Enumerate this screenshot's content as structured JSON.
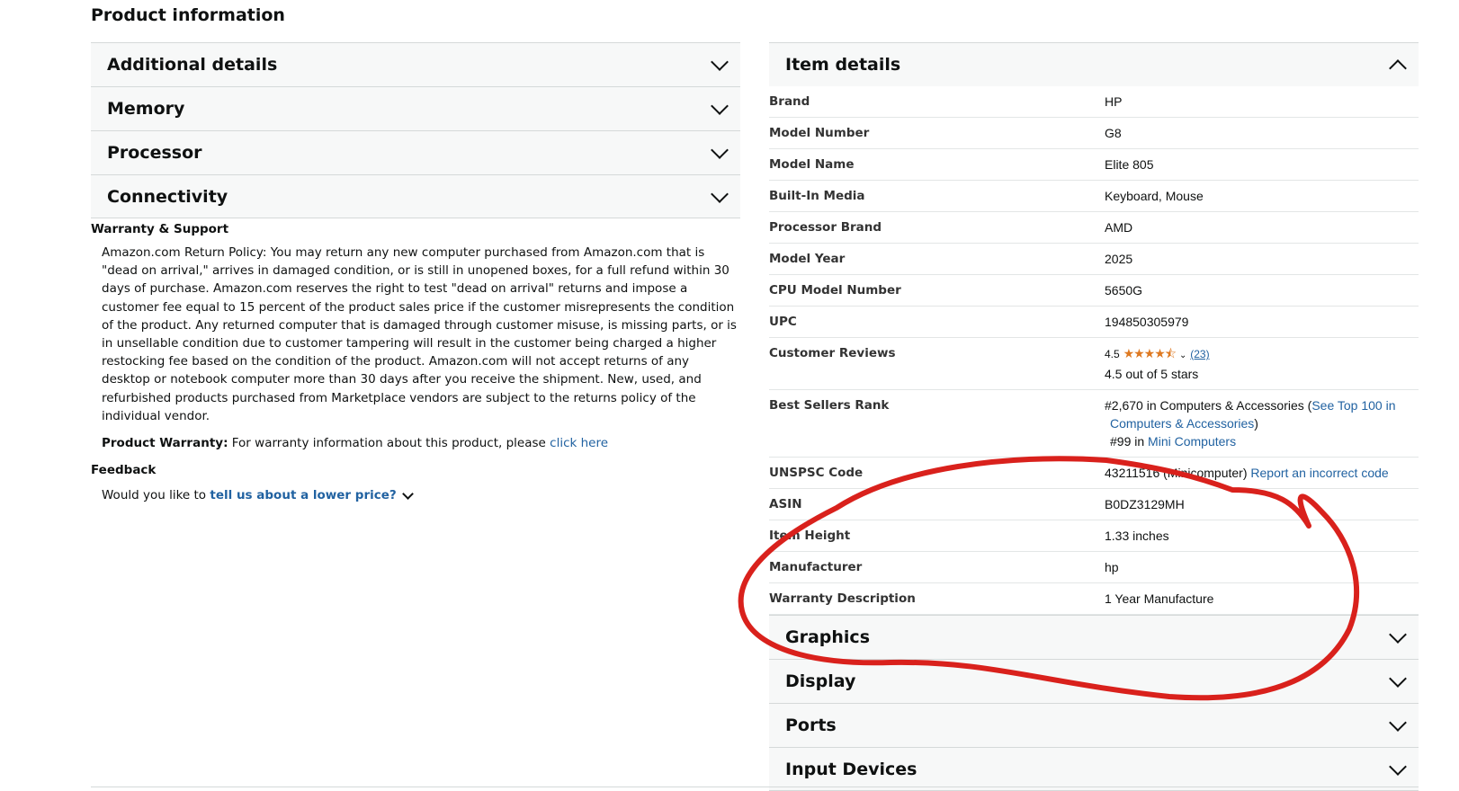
{
  "page_title": "Product information",
  "left_sections": [
    "Additional details",
    "Memory",
    "Processor",
    "Connectivity"
  ],
  "warranty_support": {
    "heading": "Warranty & Support",
    "policy_text": "Amazon.com Return Policy: You may return any new computer purchased from Amazon.com that is \"dead on arrival,\" arrives in damaged condition, or is still in unopened boxes, for a full refund within 30 days of purchase. Amazon.com reserves the right to test \"dead on arrival\" returns and impose a customer fee equal to 15 percent of the product sales price if the customer misrepresents the condition of the product. Any returned computer that is damaged through customer misuse, is missing parts, or is in unsellable condition due to customer tampering will result in the customer being charged a higher restocking fee based on the condition of the product. Amazon.com will not accept returns of any desktop or notebook computer more than 30 days after you receive the shipment. New, used, and refurbished products purchased from Marketplace vendors are subject to the returns policy of the individual vendor.",
    "warranty_label": "Product Warranty:",
    "warranty_text": "For warranty information about this product, please",
    "warranty_link": "click here"
  },
  "feedback": {
    "heading": "Feedback",
    "prefix": "Would you like to",
    "link": "tell us about a lower price?"
  },
  "item_details": {
    "title": "Item details",
    "rows": [
      {
        "key": "Brand",
        "value": "HP"
      },
      {
        "key": "Model Number",
        "value": "G8"
      },
      {
        "key": "Model Name",
        "value": "Elite 805"
      },
      {
        "key": "Built-In Media",
        "value": "Keyboard, Mouse"
      },
      {
        "key": "Processor Brand",
        "value": "AMD"
      },
      {
        "key": "Model Year",
        "value": "2025"
      },
      {
        "key": "CPU Model Number",
        "value": "5650G"
      },
      {
        "key": "UPC",
        "value": "194850305979"
      }
    ],
    "reviews": {
      "key": "Customer Reviews",
      "rating": "4.5",
      "stars": "★★★★⯪",
      "count": "(23)",
      "summary": "4.5 out of 5 stars"
    },
    "rank": {
      "key": "Best Sellers Rank",
      "line1_prefix": "#2,670 in Computers & Accessories (",
      "line1_link": "See Top 100 in Computers & Accessories",
      "line1_suffix": ")",
      "line2_prefix": "#99 in",
      "line2_link": "Mini Computers"
    },
    "unspsc": {
      "key": "UNSPSC Code",
      "value": "43211516 (Minicomputer)",
      "link": "Report an incorrect code"
    },
    "rows_after": [
      {
        "key": "ASIN",
        "value": "B0DZ3129MH"
      },
      {
        "key": "Item Height",
        "value": "1.33 inches"
      },
      {
        "key": "Manufacturer",
        "value": "hp"
      },
      {
        "key": "Warranty Description",
        "value": "1 Year Manufacture"
      }
    ]
  },
  "right_sections": [
    "Graphics",
    "Display",
    "Ports",
    "Input Devices"
  ],
  "annotation_color": "#d9211c",
  "star_color": "#de7921",
  "link_color": "#2162a1"
}
